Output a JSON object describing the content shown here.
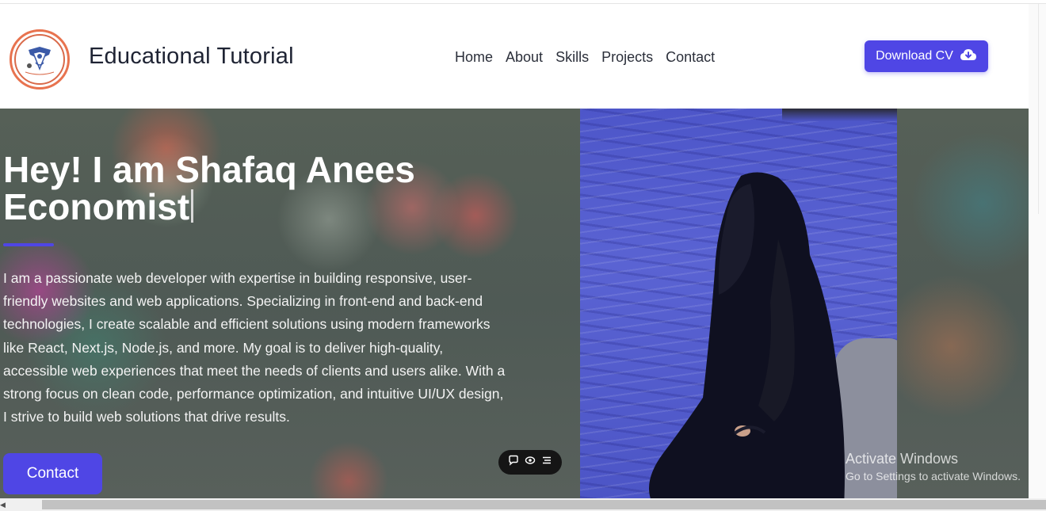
{
  "header": {
    "brand": "Educational Tutorial",
    "logo_icon": "education-badge-icon",
    "nav": [
      {
        "label": "Home"
      },
      {
        "label": "About"
      },
      {
        "label": "Skills"
      },
      {
        "label": "Projects"
      },
      {
        "label": "Contact"
      }
    ],
    "download_cv_label": "Download CV",
    "download_cv_icon": "cloud-download-icon"
  },
  "hero": {
    "title_line1": "Hey! I am Shafaq Anees",
    "title_line2": "Economist",
    "description": "I am a passionate web developer with expertise in building responsive, user-friendly websites and web applications. Specializing in front-end and back-end technologies, I create scalable and efficient solutions using modern frameworks like React, Next.js, Node.js, and more. My goal is to deliver high-quality, accessible web experiences that meet the needs of clients and users alike. With a strong focus on clean code, performance optimization, and intuitive UI/UX design, I strive to build web solutions that drive results.",
    "contact_label": "Contact",
    "photo_alt": "portrait-photo"
  },
  "widget": {
    "icons": [
      "chat-icon",
      "eye-icon",
      "menu-icon"
    ]
  },
  "watermark": {
    "line1": "Activate Windows",
    "line2": "Go to Settings to activate Windows."
  },
  "colors": {
    "accent": "#4f46e5",
    "logo_ring": "#e8734f",
    "brand_text": "#1e2333"
  }
}
